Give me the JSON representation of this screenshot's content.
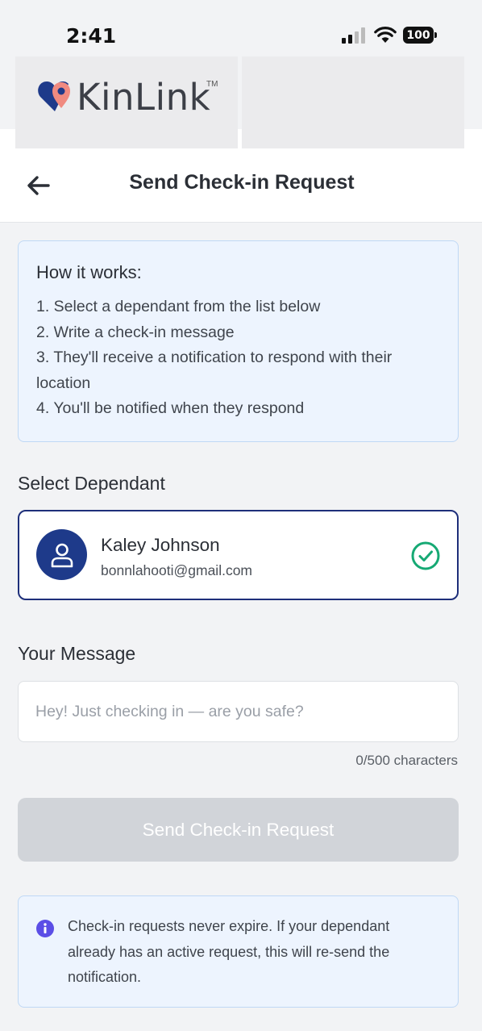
{
  "status_bar": {
    "time": "2:41",
    "battery": "100"
  },
  "brand": {
    "name": "KinLink",
    "trademark": "TM"
  },
  "header": {
    "title": "Send Check-in Request"
  },
  "how_it_works": {
    "title": "How it works:",
    "steps": [
      "1. Select a dependant from the list below",
      "2. Write a check-in message",
      "3. They'll receive a notification to respond with their location",
      "4. You'll be notified when they respond"
    ]
  },
  "select_dependant": {
    "label": "Select Dependant",
    "dependant": {
      "name": "Kaley Johnson",
      "email": "bonnlahooti@gmail.com",
      "selected": true
    }
  },
  "message": {
    "label": "Your Message",
    "value": "",
    "placeholder": "Hey! Just checking in — are you safe?",
    "char_count": "0/500 characters"
  },
  "submit": {
    "label": "Send Check-in Request",
    "enabled": false
  },
  "notice": {
    "text": "Check-in requests never expire. If your dependant already has an active request, this will re-send the notification."
  },
  "colors": {
    "primary_navy": "#1e3a8a",
    "success_green": "#16a974",
    "info_purple": "#5b4ee6",
    "logo_pink": "#f08a80",
    "info_bg": "#edf4fe"
  }
}
